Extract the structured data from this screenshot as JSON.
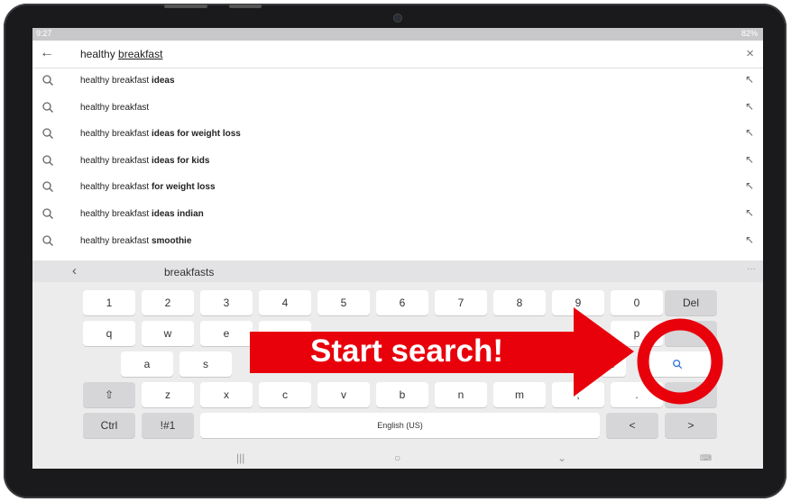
{
  "status_bar": {
    "time": "9:27",
    "battery": "82%"
  },
  "search": {
    "query_prefix": "healthy",
    "query_underlined": "breakfast"
  },
  "suggestions": [
    {
      "base": "healthy breakfast",
      "suffix": "ideas"
    },
    {
      "base": "healthy breakfast",
      "suffix": ""
    },
    {
      "base": "healthy breakfast",
      "suffix": "ideas for weight loss"
    },
    {
      "base": "healthy breakfast",
      "suffix": "ideas for kids"
    },
    {
      "base": "healthy breakfast",
      "suffix": "for weight loss"
    },
    {
      "base": "healthy breakfast",
      "suffix": "ideas indian"
    },
    {
      "base": "healthy breakfast",
      "suffix": "smoothie"
    }
  ],
  "keyboard": {
    "prediction": "breakfasts",
    "number_row": [
      "1",
      "2",
      "3",
      "4",
      "5",
      "6",
      "7",
      "8",
      "9",
      "0"
    ],
    "delete_label": "Del",
    "row_q": [
      "q",
      "w",
      "e",
      "p"
    ],
    "row_a": [
      "a",
      "s",
      "l"
    ],
    "row_z": [
      "z",
      "x",
      "c",
      "v",
      "b",
      "n",
      "m",
      ",",
      "."
    ],
    "ctrl_label": "Ctrl",
    "symbols_label": "!#1",
    "space_label": "English (US)",
    "left_label": "<",
    "right_label": ">"
  },
  "overlay": {
    "text": "Start search!",
    "color": "#e8000b"
  },
  "icons": [
    "back-arrow-icon",
    "close-icon",
    "search-icon",
    "insert-arrow-icon",
    "shift-icon",
    "recent-apps-icon",
    "home-icon",
    "back-chevron-icon",
    "keyboard-icon"
  ]
}
